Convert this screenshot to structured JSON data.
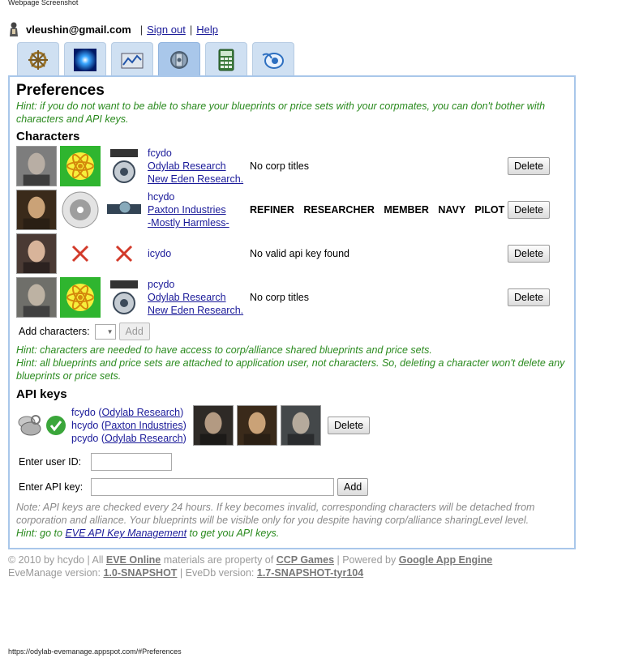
{
  "window": {
    "caption": "Webpage Screenshot",
    "status_url": "https://odylab-evemanage.appspot.com/#Preferences"
  },
  "userbar": {
    "email": "vleushin@gmail.com",
    "sign_out": "Sign out",
    "help": "Help",
    "separator": "|"
  },
  "tabs": [
    {
      "icon": "ship-wheel-icon"
    },
    {
      "icon": "blue-glow-icon"
    },
    {
      "icon": "chart-icon"
    },
    {
      "icon": "industry-icon",
      "active": true
    },
    {
      "icon": "calculator-icon"
    },
    {
      "icon": "eve-logo-icon"
    }
  ],
  "preferences": {
    "title": "Preferences",
    "hint_top": "Hint: if you do not want to be able to share your blueprints or price sets with your corpmates, you can don't bother with characters and API keys."
  },
  "characters": {
    "heading": "Characters",
    "rows": [
      {
        "name": "fcydo",
        "corp": "Odylab Research",
        "alliance": "New Eden Research.",
        "titles": "No corp titles",
        "delete": "Delete"
      },
      {
        "name": "hcydo",
        "corp": "Paxton Industries",
        "alliance": "-Mostly Harmless-",
        "titles": "REFINER RESEARCHER MEMBER NAVY PILOT",
        "delete": "Delete"
      },
      {
        "name": "icydo",
        "corp": "",
        "alliance": "",
        "titles": "No valid api key found",
        "delete": "Delete"
      },
      {
        "name": "pcydo",
        "corp": "Odylab Research",
        "alliance": "New Eden Research.",
        "titles": "No corp titles",
        "delete": "Delete"
      }
    ],
    "add_label": "Add characters:",
    "add_button": "Add",
    "hint1": "Hint: characters are needed to have access to corp/alliance shared blueprints and price sets.",
    "hint2": "Hint: all blueprints and price sets are attached to application user, not characters. So, deleting a character won't delete any blueprints or price sets."
  },
  "api_keys": {
    "heading": "API keys",
    "entry": {
      "chars": [
        {
          "name": "fcydo",
          "corp": "Odylab Research"
        },
        {
          "name": "hcydo",
          "corp": "Paxton Industries"
        },
        {
          "name": "pcydo",
          "corp": "Odylab Research"
        }
      ],
      "delete": "Delete"
    },
    "user_id_label": "Enter user ID:",
    "api_key_label": "Enter API key:",
    "add_button": "Add",
    "note": "Note: API keys are checked every 24 hours. If key becomes invalid, corresponding characters will be detached from corporation and alliance. Your blueprints will be visible only for you despite having corp/alliance sharingLevel level.",
    "hint_prefix": "Hint: go to ",
    "hint_link": "EVE API Key Management",
    "hint_suffix": " to get you API keys."
  },
  "footer": {
    "copyright": "© 2010 by hcydo | All ",
    "eve_online": "EVE Online",
    "materials": " materials are property of ",
    "ccp": "CCP Games",
    "powered": " | Powered by ",
    "gae": "Google App Engine",
    "evemanage_label": "EveManage version: ",
    "evemanage_version": "1.0-SNAPSHOT",
    "evedb_label": " | EveDb version: ",
    "evedb_version": "1.7-SNAPSHOT-tyr104"
  },
  "colors": {
    "hint": "#2a8a1e",
    "note": "#8a8a8a",
    "panel_border": "#a9c7ea",
    "link": "#1a1a99"
  }
}
